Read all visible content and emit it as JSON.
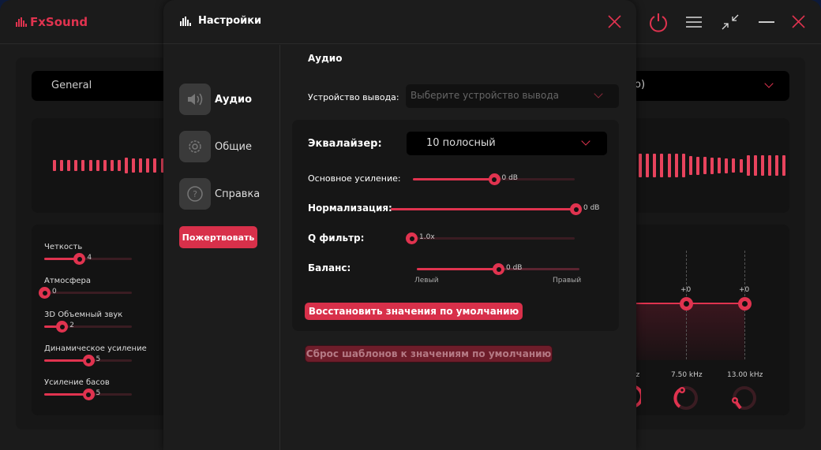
{
  "app": {
    "name": "FxSound",
    "accent": "#e0334f"
  },
  "main": {
    "preset_select": "General",
    "output_select_partial": "o)",
    "effects": [
      {
        "label": "Четкость",
        "value": "4",
        "fraction": 0.4
      },
      {
        "label": "Атмосфера",
        "value": "0",
        "fraction": 0
      },
      {
        "label": "3D Объемный звук",
        "value": "2",
        "fraction": 0.2
      },
      {
        "label": "Динамическое усиление",
        "value": "5",
        "fraction": 0.5
      },
      {
        "label": "Усиление басов",
        "value": "5",
        "fraction": 0.5
      }
    ],
    "eq": {
      "bands": [
        {
          "gain": "+0",
          "freq": "7.50 kHz"
        },
        {
          "gain": "+0",
          "freq": "13.00 kHz"
        }
      ],
      "partial_freq": "lz"
    }
  },
  "dialog": {
    "title": "Настройки",
    "nav": [
      {
        "label": "Аудио",
        "icon": "speaker-icon"
      },
      {
        "label": "Общие",
        "icon": "gear-icon"
      },
      {
        "label": "Справка",
        "icon": "help-icon"
      }
    ],
    "donate": "Пожертвовать",
    "section_title": "Аудио",
    "output_device_label": "Устройство вывода:",
    "output_device_placeholder": "Выберите устройство вывода",
    "equalizer_label": "Эквалайзер:",
    "equalizer_value": "10 полосный",
    "sliders": [
      {
        "label": "Основное усиление:",
        "value": "0 dB",
        "fraction": 0.5
      },
      {
        "label": "Нормализация:",
        "value": "0 dB",
        "fraction": 1.0
      },
      {
        "label": "Q фильтр:",
        "value": "1.0x",
        "fraction": 0
      },
      {
        "label": "Баланс:",
        "value": "0 dB",
        "fraction": 0.5
      }
    ],
    "balance_left": "Левый",
    "balance_right": "Правый",
    "restore_defaults": "Восстановить значения по умолчанию",
    "reset_presets": "Сброс шаблонов к значениям по умолчанию"
  }
}
